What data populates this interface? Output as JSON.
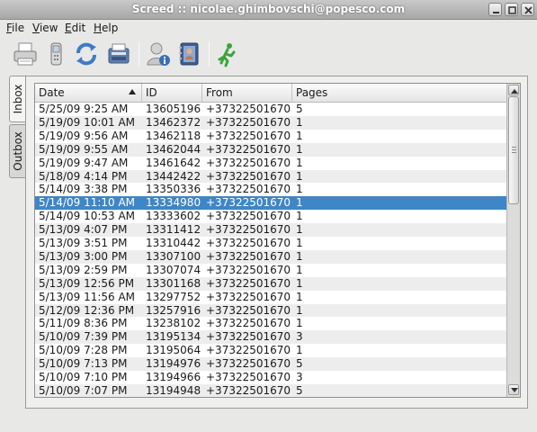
{
  "window": {
    "title": "Screed :: nicolae.ghimbovschi@popesco.com"
  },
  "menu": [
    {
      "label": "File",
      "mnemonic": "F",
      "rest": "ile"
    },
    {
      "label": "View",
      "mnemonic": "V",
      "rest": "iew"
    },
    {
      "label": "Edit",
      "mnemonic": "E",
      "rest": "dit"
    },
    {
      "label": "Help",
      "mnemonic": "H",
      "rest": "elp"
    }
  ],
  "toolbar": {
    "icons": [
      "printer-icon",
      "mobile-phone-icon",
      "refresh-icon",
      "fax-machine-icon",
      "user-info-icon",
      "address-book-icon",
      "running-man-icon"
    ]
  },
  "tabs": {
    "inbox": "Inbox",
    "outbox": "Outbox",
    "active": "inbox"
  },
  "table": {
    "columns": [
      "Date",
      "ID",
      "From",
      "Pages"
    ],
    "sort": {
      "column": "Date",
      "direction": "descending"
    },
    "selected_index": 7,
    "rows": [
      [
        "5/25/09 9:25 AM",
        "13605196",
        "+37322501670",
        "5"
      ],
      [
        "5/19/09 10:01 AM",
        "13462372",
        "+37322501670",
        "1"
      ],
      [
        "5/19/09 9:56 AM",
        "13462118",
        "+37322501670",
        "1"
      ],
      [
        "5/19/09 9:55 AM",
        "13462044",
        "+37322501670",
        "1"
      ],
      [
        "5/19/09 9:47 AM",
        "13461642",
        "+37322501670",
        "1"
      ],
      [
        "5/18/09 4:14 PM",
        "13442422",
        "+37322501670",
        "1"
      ],
      [
        "5/14/09 3:38 PM",
        "13350336",
        "+37322501670",
        "1"
      ],
      [
        "5/14/09 11:10 AM",
        "13334980",
        "+37322501670",
        "1"
      ],
      [
        "5/14/09 10:53 AM",
        "13333602",
        "+37322501670",
        "1"
      ],
      [
        "5/13/09 4:07 PM",
        "13311412",
        "+37322501670",
        "1"
      ],
      [
        "5/13/09 3:51 PM",
        "13310442",
        "+37322501670",
        "1"
      ],
      [
        "5/13/09 3:00 PM",
        "13307100",
        "+37322501670",
        "1"
      ],
      [
        "5/13/09 2:59 PM",
        "13307074",
        "+37322501670",
        "1"
      ],
      [
        "5/13/09 12:56 PM",
        "13301168",
        "+37322501670",
        "1"
      ],
      [
        "5/13/09 11:56 AM",
        "13297752",
        "+37322501670",
        "1"
      ],
      [
        "5/12/09 12:36 PM",
        "13257916",
        "+37322501670",
        "1"
      ],
      [
        "5/11/09 8:36 PM",
        "13238102",
        "+37322501670",
        "1"
      ],
      [
        "5/10/09 7:39 PM",
        "13195134",
        "+37322501670",
        "3"
      ],
      [
        "5/10/09 7:28 PM",
        "13195064",
        "+37322501670",
        "1"
      ],
      [
        "5/10/09 7:13 PM",
        "13194976",
        "+37322501670",
        "5"
      ],
      [
        "5/10/09 7:10 PM",
        "13194966",
        "+37322501670",
        "3"
      ],
      [
        "5/10/09 7:07 PM",
        "13194948",
        "+37322501670",
        "5"
      ]
    ]
  },
  "colors": {
    "selection": "#3f86c6",
    "alt_row": "#ededed"
  }
}
